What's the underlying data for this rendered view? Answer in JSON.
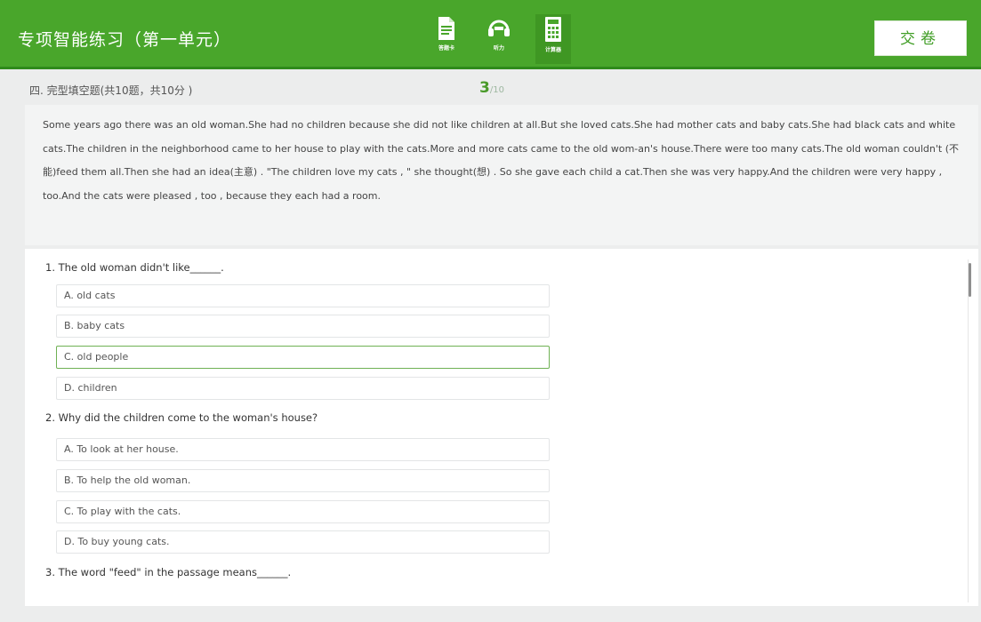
{
  "header": {
    "title": "专项智能练习（第一单元）",
    "tools": [
      {
        "icon": "document-icon",
        "label": "答题卡"
      },
      {
        "icon": "headset-icon",
        "label": "听力"
      },
      {
        "icon": "calculator-icon",
        "label": "计算器"
      }
    ],
    "submit_label": "交卷"
  },
  "section": {
    "title": "四. 完型填空题(共10题，共10分 )",
    "current": "3",
    "total": "/10"
  },
  "passage": {
    "text": "Some years ago there was an old woman.She had no children because she did not like children at all.But she loved cats.She had mother cats and baby cats.She had black cats and white cats.The children in the neighborhood came to her house to play with the cats.More and more cats came to the old wom-an's house.There were too many cats.The old woman couldn't (不能)feed them all.Then she had an idea(主意) . \"The children love my cats , \" she thought(想) . So she gave each child a cat.Then she was very happy.And the children were very happy , too.And the cats were pleased , too , because they each had a room."
  },
  "questions": [
    {
      "text": "1. The old woman didn't like______.",
      "options": [
        "A.  old cats",
        "B.  baby cats",
        "C.  old people",
        "D.  children"
      ],
      "selected_index": 2
    },
    {
      "text": "2. Why did the children come to the woman's house?",
      "options": [
        "A.  To look at her house.",
        "B.  To help the old woman.",
        "C.  To play with the cats.",
        "D.  To buy young cats."
      ],
      "selected_index": -1
    },
    {
      "text": "3. The word \"feed\" in the passage means______.",
      "options": [],
      "selected_index": -1
    }
  ],
  "colors": {
    "header_green": "#49a62b",
    "accent_green": "#4a9a2a",
    "selected_border": "#6fb154"
  }
}
